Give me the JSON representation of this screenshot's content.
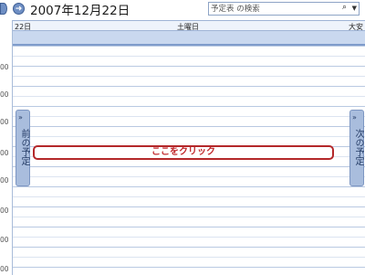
{
  "header": {
    "date_title": "2007年12月22日",
    "search_placeholder": "予定表 の検索",
    "search_icon_glyph": "⚲",
    "chevron_glyph": "▼",
    "back_glyph": "◀",
    "forward_glyph": "➜"
  },
  "day_header": {
    "day": "22日",
    "weekday": "土曜日",
    "rokuyo": "大安"
  },
  "time_labels": [
    "00",
    "00",
    "00",
    "00",
    "00",
    "00",
    "00",
    "00"
  ],
  "side_tabs": {
    "previous_label": "前の予定",
    "next_label": "次の予定",
    "arrow_glyph": "»"
  },
  "click_here": "ここをクリック",
  "colors": {
    "accent": "#c0262a",
    "header_bg": "#c9d8ef",
    "grid_line": "#dce4f1"
  }
}
